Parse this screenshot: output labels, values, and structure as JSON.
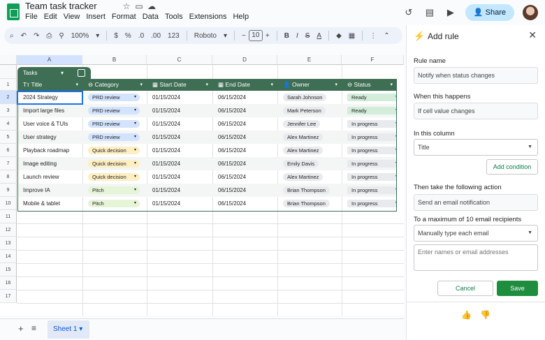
{
  "app": {
    "doc_title": "Team task tracker",
    "menu": [
      "File",
      "Edit",
      "View",
      "Insert",
      "Format",
      "Data",
      "Tools",
      "Extensions",
      "Help"
    ],
    "share_label": "Share"
  },
  "toolbar": {
    "zoom": "100%",
    "currency": "$",
    "percent": "%",
    "decimals_decrease": ".0",
    "decimals_increase": ".00",
    "number_format": "123",
    "font": "Roboto",
    "font_size": "10"
  },
  "sheet": {
    "columns": [
      "A",
      "B",
      "C",
      "D",
      "E",
      "F"
    ],
    "rows": [
      "1",
      "2",
      "3",
      "4",
      "5",
      "6",
      "7",
      "8",
      "9",
      "10",
      "11",
      "12",
      "13",
      "14",
      "15",
      "16",
      "17"
    ],
    "table_name": "Tasks",
    "headers": [
      "Title",
      "Category",
      "Start Date",
      "End Date",
      "Owner",
      "Status"
    ],
    "data": [
      {
        "title": "2024 Strategy",
        "category": "PRD review",
        "start": "01/15/2024",
        "end": "06/15/2024",
        "owner": "Sarah Johnson",
        "status": "Ready"
      },
      {
        "title": "Import large files",
        "category": "PRD review",
        "start": "01/15/2024",
        "end": "06/15/2024",
        "owner": "Mark Peterson",
        "status": "Ready"
      },
      {
        "title": "User voice & TUIs",
        "category": "PRD review",
        "start": "01/15/2024",
        "end": "06/15/2024",
        "owner": "Jennifer Lee",
        "status": "In progress"
      },
      {
        "title": "User strategy",
        "category": "PRD review",
        "start": "01/15/2024",
        "end": "06/15/2024",
        "owner": "Alex Martinez",
        "status": "In progress"
      },
      {
        "title": "Playback roadmap",
        "category": "Quick decision",
        "start": "01/15/2024",
        "end": "06/15/2024",
        "owner": "Alex Martinez",
        "status": "In progress"
      },
      {
        "title": "Image editing",
        "category": "Quick decision",
        "start": "01/15/2024",
        "end": "06/15/2024",
        "owner": "Emily Davis",
        "status": "In progress"
      },
      {
        "title": "Launch review",
        "category": "Quick decision",
        "start": "01/15/2024",
        "end": "06/15/2024",
        "owner": "Alex Martinez",
        "status": "In progress"
      },
      {
        "title": "Improve IA",
        "category": "Pitch",
        "start": "01/15/2024",
        "end": "06/15/2024",
        "owner": "Brian Thompson",
        "status": "In progress"
      },
      {
        "title": "Mobile & tablet",
        "category": "Pitch",
        "start": "01/15/2024",
        "end": "06/15/2024",
        "owner": "Brian Thompson",
        "status": "In progress"
      }
    ],
    "sheet_tab": "Sheet 1"
  },
  "colors": {
    "table_header": "#3e6e54",
    "prd_review": "#d3e3fd",
    "quick_decision": "#fdefc3",
    "pitch": "#e6f4d7",
    "ready": "#d4edda",
    "in_progress": "#e8eaed",
    "primary_button": "#1e8e3e"
  },
  "panel": {
    "title": "Add rule",
    "rule_name_label": "Rule name",
    "rule_name_value": "Notify when status changes",
    "when_label": "When this happens",
    "when_value": "If cell value changes",
    "column_label": "In this column",
    "column_value": "Title",
    "add_condition": "Add condition",
    "action_label": "Then take the following action",
    "action_value": "Send an email notification",
    "recipients_label": "To a maximum of 10 email recipients",
    "recipients_mode": "Manually type each email",
    "recipients_placeholder": "Enter names or email addresses",
    "cancel": "Cancel",
    "save": "Save"
  }
}
